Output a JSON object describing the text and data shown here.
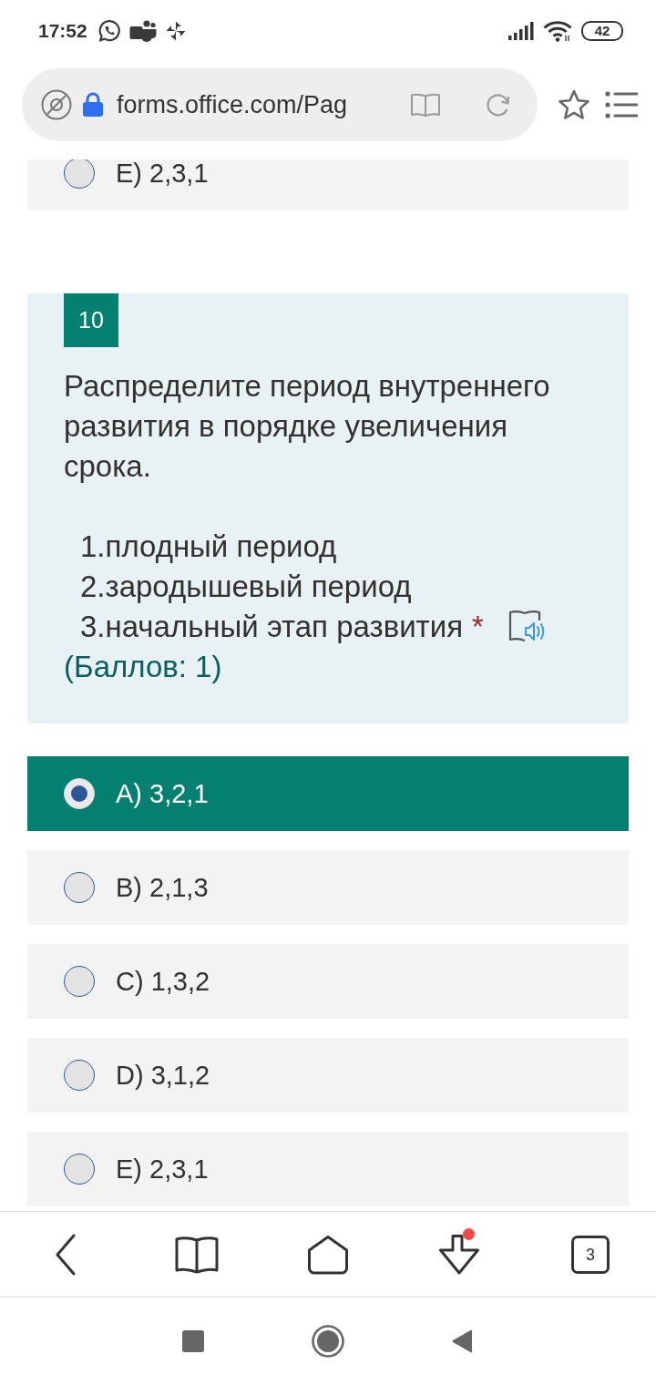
{
  "status_bar": {
    "time": "17:52",
    "battery": "42"
  },
  "address_bar": {
    "url": "forms.office.com/Pag"
  },
  "previous_question": {
    "options": [
      {
        "label": "E) 2,3,1",
        "selected": false
      }
    ]
  },
  "question": {
    "number": "10",
    "text": "Распределите период внутреннего развития в порядке увеличения срока.",
    "items": [
      "1.плодный период",
      "2.зародышевый период",
      "3.начальный этап развития"
    ],
    "required_mark": "*",
    "points": "(Баллов: 1)",
    "options": [
      {
        "label": "A) 3,2,1",
        "selected": true
      },
      {
        "label": "B) 2,1,3",
        "selected": false
      },
      {
        "label": "C) 1,3,2",
        "selected": false
      },
      {
        "label": "D) 3,1,2",
        "selected": false
      },
      {
        "label": "E) 2,3,1",
        "selected": false
      }
    ]
  },
  "bottom_toolbar": {
    "tab_count": "3",
    "download_notification": true
  }
}
